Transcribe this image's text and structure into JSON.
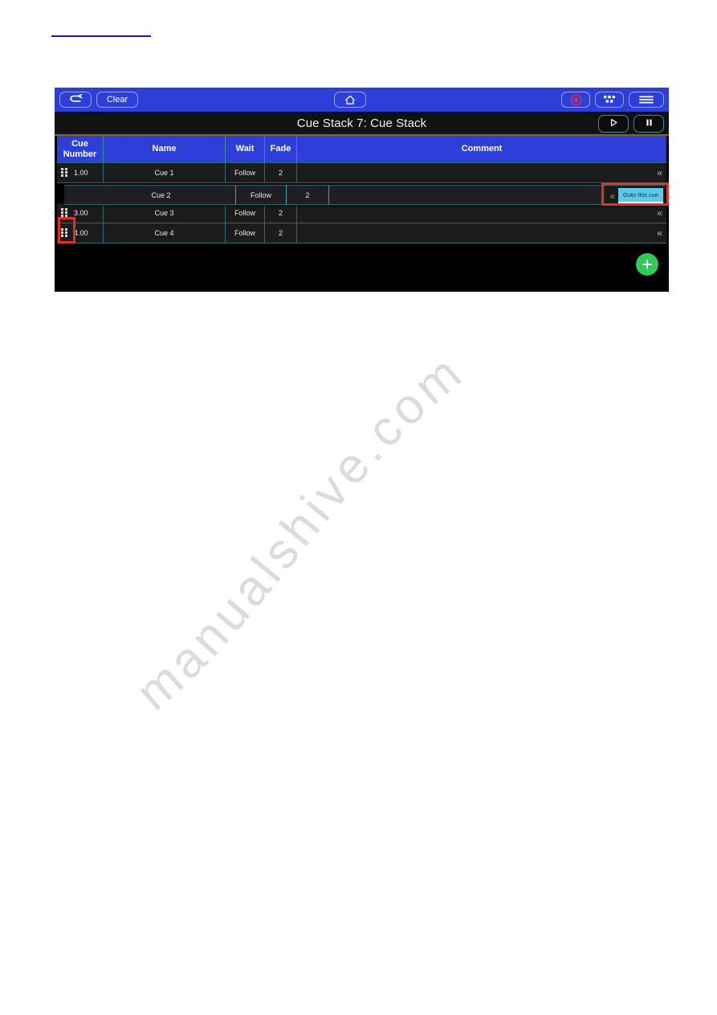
{
  "document": {
    "redacted_link_present": true
  },
  "app": {
    "toolbar": {
      "back_label": "↶",
      "back_icon": "back-arrow-icon",
      "clear_label": "Clear",
      "home_icon": "home-icon",
      "record_icon": "record-icon",
      "grid_icon": "grid-apps-icon",
      "menu_icon": "hamburger-menu-icon",
      "accent_blue": "#2d3fd8",
      "outline_blue": "#93a6f5"
    },
    "titlebar": {
      "title": "Cue Stack 7: Cue Stack",
      "play_icon": "play-icon",
      "pause_icon": "pause-icon",
      "underline_color": "#8a6321"
    },
    "table": {
      "columns": [
        {
          "key": "cue_number",
          "label": "Cue\nNumber",
          "label_line1": "Cue",
          "label_line2": "Number"
        },
        {
          "key": "name",
          "label": "Name"
        },
        {
          "key": "wait",
          "label": "Wait"
        },
        {
          "key": "fade",
          "label": "Fade"
        },
        {
          "key": "comment",
          "label": "Comment"
        }
      ],
      "rows": [
        {
          "cue_number": "1.00",
          "name": "Cue 1",
          "wait": "Follow",
          "fade": "2",
          "comment": "",
          "dragging": false,
          "expand_icon": "double-chevron-left-icon"
        },
        {
          "cue_number": "",
          "name": "Cue 2",
          "wait": "Follow",
          "fade": "2",
          "comment": "",
          "dragging": true,
          "expand_icon": "double-chevron-left-icon"
        },
        {
          "cue_number": "3.00",
          "name": "Cue 3",
          "wait": "Follow",
          "fade": "2",
          "comment": "",
          "dragging": false,
          "expand_icon": "double-chevron-left-icon"
        },
        {
          "cue_number": "4.00",
          "name": "Cue 4",
          "wait": "Follow",
          "fade": "2",
          "comment": "",
          "dragging": false,
          "expand_icon": "double-chevron-left-icon"
        }
      ],
      "drag_handle_icon": "drag-handle-icon",
      "grid_line_color": "#2a6a75"
    },
    "goto_popup": {
      "label": "Goto this cue",
      "chevron_icon": "double-chevron-left-icon",
      "background": "#5ec8e8"
    },
    "add_button": {
      "icon": "plus-icon",
      "color": "#2ecc57"
    },
    "annotations": [
      {
        "name": "goto-this-cue-highlight",
        "color": "#e03124"
      },
      {
        "name": "drag-handle-highlight",
        "color": "#e03124"
      }
    ]
  },
  "watermark": {
    "text": "manualshive.com"
  }
}
